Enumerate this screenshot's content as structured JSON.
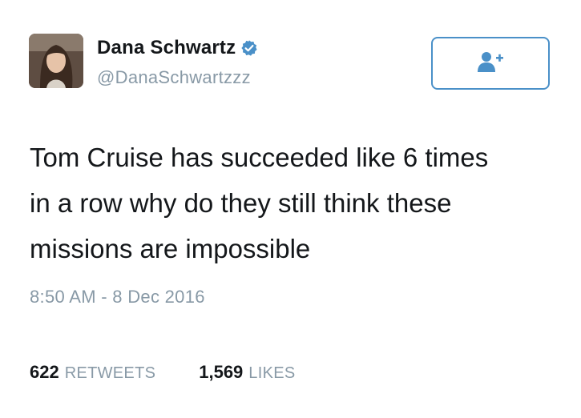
{
  "user": {
    "display_name": "Dana Schwartz",
    "handle": "@DanaSchwartzzz",
    "verified": true
  },
  "icons": {
    "verified": "verified-badge-icon",
    "follow": "add-user-icon"
  },
  "colors": {
    "accent": "#4a90c8",
    "muted": "#8899a6",
    "text": "#14171a"
  },
  "tweet": {
    "text": "Tom Cruise has succeeded like 6 times\nin a row why do they still think these\nmissions are impossible",
    "timestamp": "8:50 AM - 8 Dec 2016"
  },
  "stats": {
    "retweets_count": "622",
    "retweets_label": "RETWEETS",
    "likes_count": "1,569",
    "likes_label": "LIKES"
  }
}
